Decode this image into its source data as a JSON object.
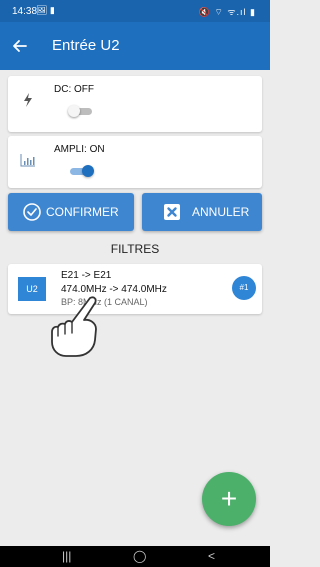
{
  "status_bar": {
    "time": "14:38",
    "left_icons": "🖼 ▮",
    "right_icons": "🔇 ⌔ ᯤ.ıl ▮"
  },
  "app_bar": {
    "title": "Entrée U2",
    "back_icon": "arrow-left"
  },
  "settings": {
    "dc": {
      "label": "DC: OFF",
      "enabled": false,
      "icon": "lightning-bolt"
    },
    "ampli": {
      "label": "AMPLI: ON",
      "enabled": true,
      "icon": "signal-bars"
    }
  },
  "actions": {
    "confirm_label": "CONFIRMER",
    "cancel_label": "ANNULER"
  },
  "filters": {
    "section_title": "FILTRES",
    "items": [
      {
        "tag": "U2",
        "line1": "E21 -> E21",
        "line2": "474.0MHz -> 474.0MHz",
        "line3": "BP: 8MHz (1 CANAL)",
        "number": "#1"
      }
    ]
  },
  "fab": {
    "label": "+"
  },
  "nav_bar": {
    "recents": "|||",
    "home": "◯",
    "back": "<"
  },
  "colors": {
    "primary": "#1f6fbf",
    "status_bar": "#1a64ad",
    "button": "#3f86d1",
    "fab": "#4caf6a",
    "background": "#ececec"
  }
}
